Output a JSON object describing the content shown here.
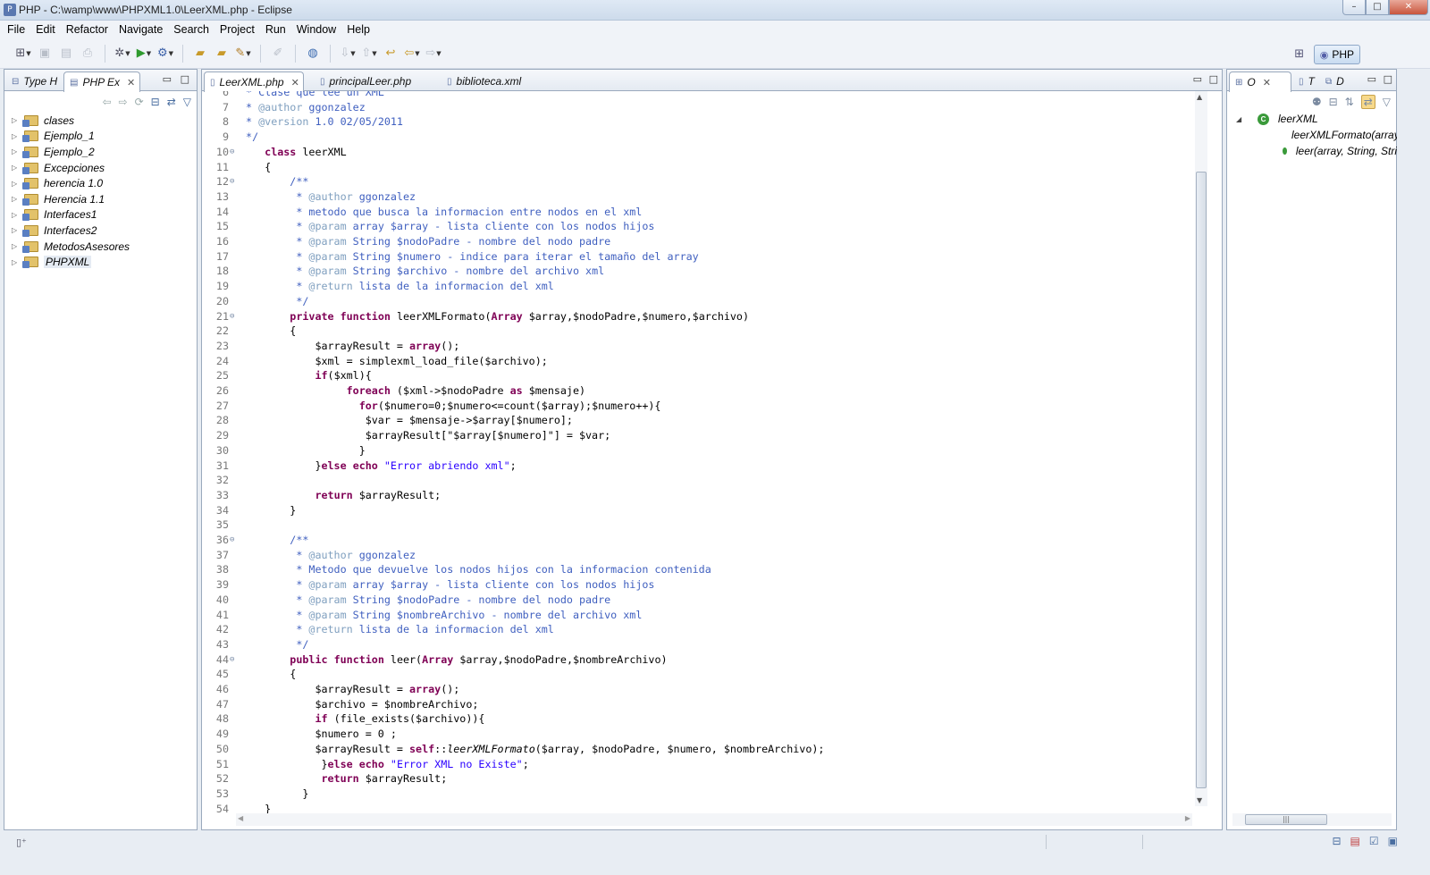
{
  "window": {
    "title": "PHP - C:\\wamp\\www\\PHPXML1.0\\LeerXML.php - Eclipse",
    "controls": [
      "minimize",
      "maximize",
      "close"
    ]
  },
  "menu": [
    "File",
    "Edit",
    "Refactor",
    "Navigate",
    "Search",
    "Project",
    "Run",
    "Window",
    "Help"
  ],
  "perspective": {
    "label": "PHP"
  },
  "left_panel": {
    "tabs": [
      {
        "label": "Type H"
      },
      {
        "label": "PHP Ex"
      }
    ],
    "tree": [
      {
        "label": "clases"
      },
      {
        "label": "Ejemplo_1"
      },
      {
        "label": "Ejemplo_2"
      },
      {
        "label": "Excepciones"
      },
      {
        "label": "herencia 1.0"
      },
      {
        "label": "Herencia 1.1"
      },
      {
        "label": "Interfaces1"
      },
      {
        "label": "Interfaces2"
      },
      {
        "label": "MetodosAsesores"
      },
      {
        "label": "PHPXML"
      }
    ]
  },
  "editor": {
    "tabs": [
      {
        "label": "LeerXML.php"
      },
      {
        "label": "principalLeer.php"
      },
      {
        "label": "biblioteca.xml"
      }
    ],
    "lines": [
      {
        "n": "6",
        "fold": "",
        "segs": [
          {
            "t": " * Clase que lee un XML",
            "c": "c"
          }
        ]
      },
      {
        "n": "7",
        "fold": "",
        "segs": [
          {
            "t": " * ",
            "c": "c"
          },
          {
            "t": "@author",
            "c": "ct"
          },
          {
            "t": " ggonzalez",
            "c": "c"
          }
        ]
      },
      {
        "n": "8",
        "fold": "",
        "segs": [
          {
            "t": " * ",
            "c": "c"
          },
          {
            "t": "@version",
            "c": "ct"
          },
          {
            "t": " 1.0 02/05/2011",
            "c": "c"
          }
        ]
      },
      {
        "n": "9",
        "fold": "",
        "segs": [
          {
            "t": " */",
            "c": "c"
          }
        ]
      },
      {
        "n": "10",
        "fold": "⊖",
        "segs": [
          {
            "t": "    ",
            "c": "v"
          },
          {
            "t": "class",
            "c": "k"
          },
          {
            "t": " leerXML",
            "c": "v"
          }
        ]
      },
      {
        "n": "11",
        "fold": "",
        "segs": [
          {
            "t": "    {",
            "c": "v"
          }
        ]
      },
      {
        "n": "12",
        "fold": "⊖",
        "segs": [
          {
            "t": "        /**",
            "c": "c"
          }
        ]
      },
      {
        "n": "13",
        "fold": "",
        "segs": [
          {
            "t": "         * ",
            "c": "c"
          },
          {
            "t": "@author",
            "c": "ct"
          },
          {
            "t": " ggonzalez",
            "c": "c"
          }
        ]
      },
      {
        "n": "14",
        "fold": "",
        "segs": [
          {
            "t": "         * metodo que busca la informacion entre nodos en el xml",
            "c": "c"
          }
        ]
      },
      {
        "n": "15",
        "fold": "",
        "segs": [
          {
            "t": "         * ",
            "c": "c"
          },
          {
            "t": "@param",
            "c": "ct"
          },
          {
            "t": " array $array - lista cliente con los nodos hijos",
            "c": "c"
          }
        ]
      },
      {
        "n": "16",
        "fold": "",
        "segs": [
          {
            "t": "         * ",
            "c": "c"
          },
          {
            "t": "@param",
            "c": "ct"
          },
          {
            "t": " String $nodoPadre - nombre del nodo padre",
            "c": "c"
          }
        ]
      },
      {
        "n": "17",
        "fold": "",
        "segs": [
          {
            "t": "         * ",
            "c": "c"
          },
          {
            "t": "@param",
            "c": "ct"
          },
          {
            "t": " String $numero - indice para iterar el tamaño del array",
            "c": "c"
          }
        ]
      },
      {
        "n": "18",
        "fold": "",
        "segs": [
          {
            "t": "         * ",
            "c": "c"
          },
          {
            "t": "@param",
            "c": "ct"
          },
          {
            "t": " String $archivo - nombre del archivo xml",
            "c": "c"
          }
        ]
      },
      {
        "n": "19",
        "fold": "",
        "segs": [
          {
            "t": "         * ",
            "c": "c"
          },
          {
            "t": "@return",
            "c": "ct"
          },
          {
            "t": " lista de la informacion del xml",
            "c": "c"
          }
        ]
      },
      {
        "n": "20",
        "fold": "",
        "segs": [
          {
            "t": "         */",
            "c": "c"
          }
        ]
      },
      {
        "n": "21",
        "fold": "⊖",
        "segs": [
          {
            "t": "        ",
            "c": "v"
          },
          {
            "t": "private",
            "c": "k"
          },
          {
            "t": " ",
            "c": "v"
          },
          {
            "t": "function",
            "c": "k"
          },
          {
            "t": " leerXMLFormato(",
            "c": "v"
          },
          {
            "t": "Array",
            "c": "k"
          },
          {
            "t": " $array,$nodoPadre,$numero,$archivo)",
            "c": "v"
          }
        ]
      },
      {
        "n": "22",
        "fold": "",
        "segs": [
          {
            "t": "        {",
            "c": "v"
          }
        ]
      },
      {
        "n": "23",
        "fold": "",
        "segs": [
          {
            "t": "            $arrayResult = ",
            "c": "v"
          },
          {
            "t": "array",
            "c": "k"
          },
          {
            "t": "();",
            "c": "v"
          }
        ]
      },
      {
        "n": "24",
        "fold": "",
        "segs": [
          {
            "t": "            $xml = simplexml_load_file($archivo);",
            "c": "v"
          }
        ]
      },
      {
        "n": "25",
        "fold": "",
        "segs": [
          {
            "t": "            ",
            "c": "v"
          },
          {
            "t": "if",
            "c": "k"
          },
          {
            "t": "($xml){",
            "c": "v"
          }
        ]
      },
      {
        "n": "26",
        "fold": "",
        "segs": [
          {
            "t": "                 ",
            "c": "v"
          },
          {
            "t": "foreach",
            "c": "k"
          },
          {
            "t": " ($xml->$nodoPadre ",
            "c": "v"
          },
          {
            "t": "as",
            "c": "k"
          },
          {
            "t": " $mensaje)",
            "c": "v"
          }
        ]
      },
      {
        "n": "27",
        "fold": "",
        "segs": [
          {
            "t": "                   ",
            "c": "v"
          },
          {
            "t": "for",
            "c": "k"
          },
          {
            "t": "($numero=0;$numero<=count($array);$numero++){",
            "c": "v"
          }
        ]
      },
      {
        "n": "28",
        "fold": "",
        "segs": [
          {
            "t": "                    $var = $mensaje->$array[$numero];",
            "c": "v"
          }
        ]
      },
      {
        "n": "29",
        "fold": "",
        "segs": [
          {
            "t": "                    $arrayResult[\"$array[$numero]\"] = $var;",
            "c": "v"
          }
        ]
      },
      {
        "n": "30",
        "fold": "",
        "segs": [
          {
            "t": "                   }",
            "c": "v"
          }
        ]
      },
      {
        "n": "31",
        "fold": "",
        "segs": [
          {
            "t": "            }",
            "c": "v"
          },
          {
            "t": "else",
            "c": "k"
          },
          {
            "t": " ",
            "c": "v"
          },
          {
            "t": "echo",
            "c": "k"
          },
          {
            "t": " ",
            "c": "v"
          },
          {
            "t": "\"Error abriendo xml\"",
            "c": "s"
          },
          {
            "t": ";",
            "c": "v"
          }
        ]
      },
      {
        "n": "32",
        "fold": "",
        "segs": [
          {
            "t": "",
            "c": "v"
          }
        ]
      },
      {
        "n": "33",
        "fold": "",
        "segs": [
          {
            "t": "            ",
            "c": "v"
          },
          {
            "t": "return",
            "c": "k"
          },
          {
            "t": " $arrayResult;",
            "c": "v"
          }
        ]
      },
      {
        "n": "34",
        "fold": "",
        "segs": [
          {
            "t": "        }",
            "c": "v"
          }
        ]
      },
      {
        "n": "35",
        "fold": "",
        "segs": [
          {
            "t": "",
            "c": "v"
          }
        ]
      },
      {
        "n": "36",
        "fold": "⊖",
        "segs": [
          {
            "t": "        /**",
            "c": "c"
          }
        ]
      },
      {
        "n": "37",
        "fold": "",
        "segs": [
          {
            "t": "         * ",
            "c": "c"
          },
          {
            "t": "@author",
            "c": "ct"
          },
          {
            "t": " ggonzalez",
            "c": "c"
          }
        ]
      },
      {
        "n": "38",
        "fold": "",
        "segs": [
          {
            "t": "         * Metodo que devuelve los nodos hijos con la informacion contenida",
            "c": "c"
          }
        ]
      },
      {
        "n": "39",
        "fold": "",
        "segs": [
          {
            "t": "         * ",
            "c": "c"
          },
          {
            "t": "@param",
            "c": "ct"
          },
          {
            "t": " array $array - lista cliente con los nodos hijos",
            "c": "c"
          }
        ]
      },
      {
        "n": "40",
        "fold": "",
        "segs": [
          {
            "t": "         * ",
            "c": "c"
          },
          {
            "t": "@param",
            "c": "ct"
          },
          {
            "t": " String $nodoPadre - nombre del nodo padre",
            "c": "c"
          }
        ]
      },
      {
        "n": "41",
        "fold": "",
        "segs": [
          {
            "t": "         * ",
            "c": "c"
          },
          {
            "t": "@param",
            "c": "ct"
          },
          {
            "t": " String $nombreArchivo - nombre del archivo xml",
            "c": "c"
          }
        ]
      },
      {
        "n": "42",
        "fold": "",
        "segs": [
          {
            "t": "         * ",
            "c": "c"
          },
          {
            "t": "@return",
            "c": "ct"
          },
          {
            "t": " lista de la informacion del xml",
            "c": "c"
          }
        ]
      },
      {
        "n": "43",
        "fold": "",
        "segs": [
          {
            "t": "         */",
            "c": "c"
          }
        ]
      },
      {
        "n": "44",
        "fold": "⊖",
        "segs": [
          {
            "t": "        ",
            "c": "v"
          },
          {
            "t": "public",
            "c": "k"
          },
          {
            "t": " ",
            "c": "v"
          },
          {
            "t": "function",
            "c": "k"
          },
          {
            "t": " leer(",
            "c": "v"
          },
          {
            "t": "Array",
            "c": "k"
          },
          {
            "t": " $array,$nodoPadre,$nombreArchivo)",
            "c": "v"
          }
        ]
      },
      {
        "n": "45",
        "fold": "",
        "segs": [
          {
            "t": "        {",
            "c": "v"
          }
        ]
      },
      {
        "n": "46",
        "fold": "",
        "segs": [
          {
            "t": "            $arrayResult = ",
            "c": "v"
          },
          {
            "t": "array",
            "c": "k"
          },
          {
            "t": "();",
            "c": "v"
          }
        ]
      },
      {
        "n": "47",
        "fold": "",
        "segs": [
          {
            "t": "            $archivo = $nombreArchivo;",
            "c": "v"
          }
        ]
      },
      {
        "n": "48",
        "fold": "",
        "segs": [
          {
            "t": "            ",
            "c": "v"
          },
          {
            "t": "if",
            "c": "k"
          },
          {
            "t": " (file_exists($archivo)){",
            "c": "v"
          }
        ]
      },
      {
        "n": "49",
        "fold": "",
        "segs": [
          {
            "t": "            $numero = 0 ;",
            "c": "v"
          }
        ]
      },
      {
        "n": "50",
        "fold": "",
        "segs": [
          {
            "t": "            $arrayResult = ",
            "c": "v"
          },
          {
            "t": "self",
            "c": "k"
          },
          {
            "t": "::",
            "c": "v"
          },
          {
            "t": "leerXMLFormato",
            "c": "it"
          },
          {
            "t": "($array, $nodoPadre, $numero, $nombreArchivo);",
            "c": "v"
          }
        ]
      },
      {
        "n": "51",
        "fold": "",
        "segs": [
          {
            "t": "             }",
            "c": "v"
          },
          {
            "t": "else",
            "c": "k"
          },
          {
            "t": " ",
            "c": "v"
          },
          {
            "t": "echo",
            "c": "k"
          },
          {
            "t": " ",
            "c": "v"
          },
          {
            "t": "\"Error XML no Existe\"",
            "c": "s"
          },
          {
            "t": ";",
            "c": "v"
          }
        ]
      },
      {
        "n": "52",
        "fold": "",
        "segs": [
          {
            "t": "             ",
            "c": "v"
          },
          {
            "t": "return",
            "c": "k"
          },
          {
            "t": " $arrayResult;",
            "c": "v"
          }
        ]
      },
      {
        "n": "53",
        "fold": "",
        "segs": [
          {
            "t": "          }",
            "c": "v"
          }
        ]
      },
      {
        "n": "54",
        "fold": "",
        "segs": [
          {
            "t": "    }",
            "c": "v"
          }
        ]
      }
    ]
  },
  "outline_panel": {
    "tabs": [
      {
        "label": "O"
      },
      {
        "label": "T"
      },
      {
        "label": "D"
      }
    ],
    "tree": [
      {
        "label": "leerXML",
        "kind": "class"
      },
      {
        "label": "leerXMLFormato(array",
        "kind": "private"
      },
      {
        "label": "leer(array, String, Stri",
        "kind": "public"
      }
    ]
  },
  "colors": {
    "keyword": "#7f0055",
    "comment": "#3f5fbf",
    "comment_tag": "#7f9fbf",
    "string": "#2a00ff"
  }
}
